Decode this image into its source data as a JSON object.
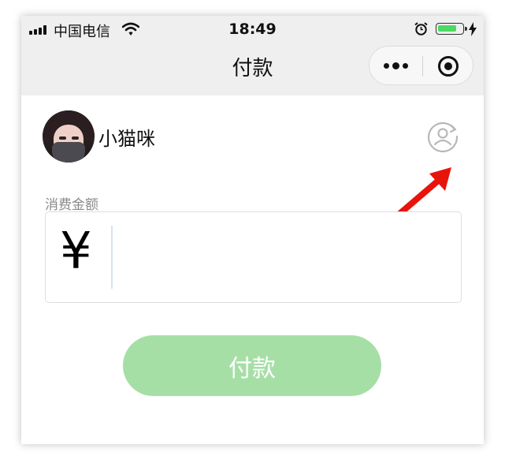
{
  "status_bar": {
    "carrier": "中国电信",
    "time": "18:49",
    "signal_icon": "signal-bars-icon",
    "wifi_icon": "wifi-icon",
    "alarm_icon": "alarm-clock-icon",
    "battery_icon": "battery-icon",
    "charging_icon": "charging-bolt-icon",
    "battery_level": 0.75,
    "battery_color": "#4cd964"
  },
  "nav": {
    "title": "付款",
    "more_icon": "more-dots-icon",
    "close_icon": "target-circle-icon"
  },
  "payee": {
    "name": "小猫咪",
    "avatar": "avatar-photo",
    "switch_icon": "switch-account-icon"
  },
  "amount": {
    "label": "消费金额",
    "currency_symbol": "¥",
    "value": ""
  },
  "pay_button": {
    "label": "付款",
    "color": "#a6dfa6"
  },
  "annotation": {
    "arrow_icon": "red-arrow-icon",
    "arrow_color": "#e8140c"
  }
}
